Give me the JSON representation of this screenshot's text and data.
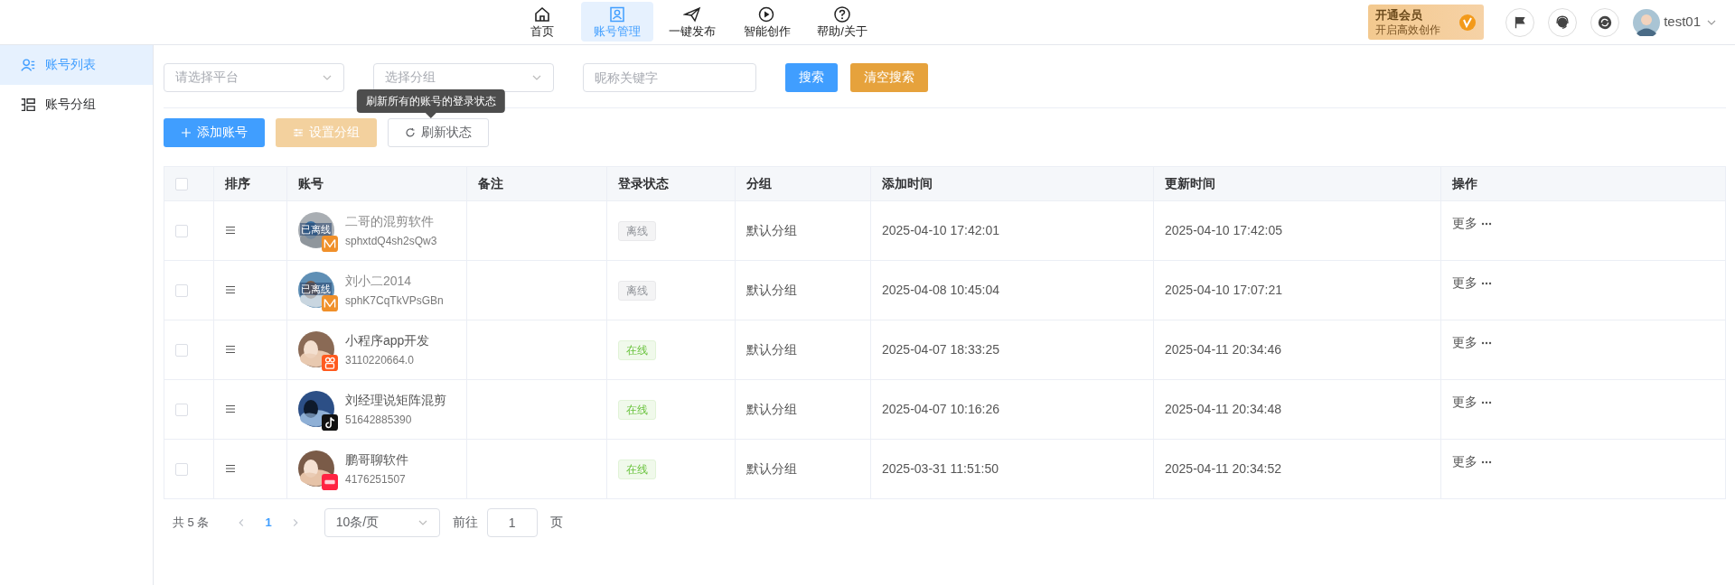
{
  "nav": [
    {
      "label": "首页",
      "selected": false
    },
    {
      "label": "账号管理",
      "selected": true
    },
    {
      "label": "一键发布",
      "selected": false
    },
    {
      "label": "智能创作",
      "selected": false
    },
    {
      "label": "帮助/关于",
      "selected": false
    }
  ],
  "vip": {
    "title": "开通会员",
    "subtitle": "开启高效创作"
  },
  "user": {
    "name": "test01"
  },
  "sidebar": [
    {
      "label": "账号列表",
      "selected": true
    },
    {
      "label": "账号分组",
      "selected": false
    }
  ],
  "filters": {
    "platform_placeholder": "请选择平台",
    "group_placeholder": "选择分组",
    "keyword_placeholder": "昵称关键字",
    "search_button": "搜索",
    "clear_button": "清空搜索"
  },
  "toolbar": [
    {
      "label": "添加账号",
      "kind": "primary",
      "disabled": false
    },
    {
      "label": "设置分组",
      "kind": "warning",
      "disabled": true
    },
    {
      "label": "刷新状态",
      "kind": "plain",
      "disabled": false
    }
  ],
  "tooltip": "刷新所有的账号的登录状态",
  "table": {
    "header_checked": false,
    "columns": [
      "排序",
      "账号",
      "备注",
      "登录状态",
      "分组",
      "添加时间",
      "更新时间",
      "操作"
    ],
    "rows": [
      {
        "checked": false,
        "name": "二哥的混剪软件",
        "id": "sphxtdQ4sh2sQw3",
        "avatar_overlay": "已离线",
        "kind": "bow",
        "status": "离线",
        "online": false,
        "group": "默认分组",
        "added": "2025-04-10 17:42:01",
        "updated": "2025-04-10 17:42:05",
        "action": "更多"
      },
      {
        "checked": false,
        "name": "刘小二2014",
        "id": "sphK7CqTkVPsGBn",
        "avatar_overlay": "已离线",
        "kind": "bow",
        "status": "离线",
        "online": false,
        "group": "默认分组",
        "added": "2025-04-08 10:45:04",
        "updated": "2025-04-10 17:07:21",
        "action": "更多"
      },
      {
        "checked": false,
        "name": "小程序app开发",
        "id": "3110220664.0",
        "kind": "camera",
        "status": "在线",
        "online": true,
        "group": "默认分组",
        "added": "2025-04-07 18:33:25",
        "updated": "2025-04-11 20:34:46",
        "action": "更多"
      },
      {
        "checked": false,
        "name": "刘经理说矩阵混剪",
        "id": "51642885390",
        "kind": "note",
        "status": "在线",
        "online": true,
        "group": "默认分组",
        "added": "2025-04-07 10:16:26",
        "updated": "2025-04-11 20:34:48",
        "action": "更多"
      },
      {
        "checked": false,
        "name": "鹏哥聊软件",
        "id": "4176251507",
        "kind": "tile",
        "status": "在线",
        "online": true,
        "group": "默认分组",
        "added": "2025-03-31 11:51:50",
        "updated": "2025-04-11 20:34:52",
        "action": "更多"
      }
    ]
  },
  "pagination": {
    "total": "共 5 条",
    "pages": [
      {
        "label": "1",
        "selected": true
      }
    ],
    "page_size": "10条/页",
    "goto": "前往",
    "page_value": "1",
    "page_suffix": "页"
  }
}
